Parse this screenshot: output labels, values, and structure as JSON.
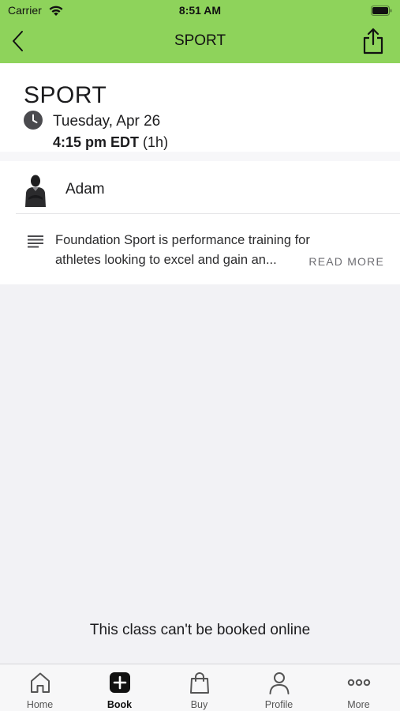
{
  "status_bar": {
    "carrier": "Carrier",
    "time": "8:51 AM"
  },
  "nav": {
    "title": "SPORT"
  },
  "class_info": {
    "title": "SPORT",
    "date": "Tuesday, Apr 26",
    "time": "4:15 pm EDT",
    "duration": "(1h)"
  },
  "instructor": {
    "name": "Adam"
  },
  "description": {
    "line1": "Foundation Sport is performance training for",
    "line2": "athletes looking to excel and gain an...",
    "read_more": "READ MORE"
  },
  "notice": "This class can't be booked online",
  "tabs": [
    {
      "label": "Home",
      "icon": "home-icon"
    },
    {
      "label": "Book",
      "icon": "plus-icon",
      "active": true
    },
    {
      "label": "Buy",
      "icon": "shopping-bag-icon"
    },
    {
      "label": "Profile",
      "icon": "person-icon"
    },
    {
      "label": "More",
      "icon": "more-dots-icon"
    }
  ],
  "colors": {
    "header_green": "#8ed35b",
    "background": "#f2f2f5",
    "card": "#ffffff"
  }
}
